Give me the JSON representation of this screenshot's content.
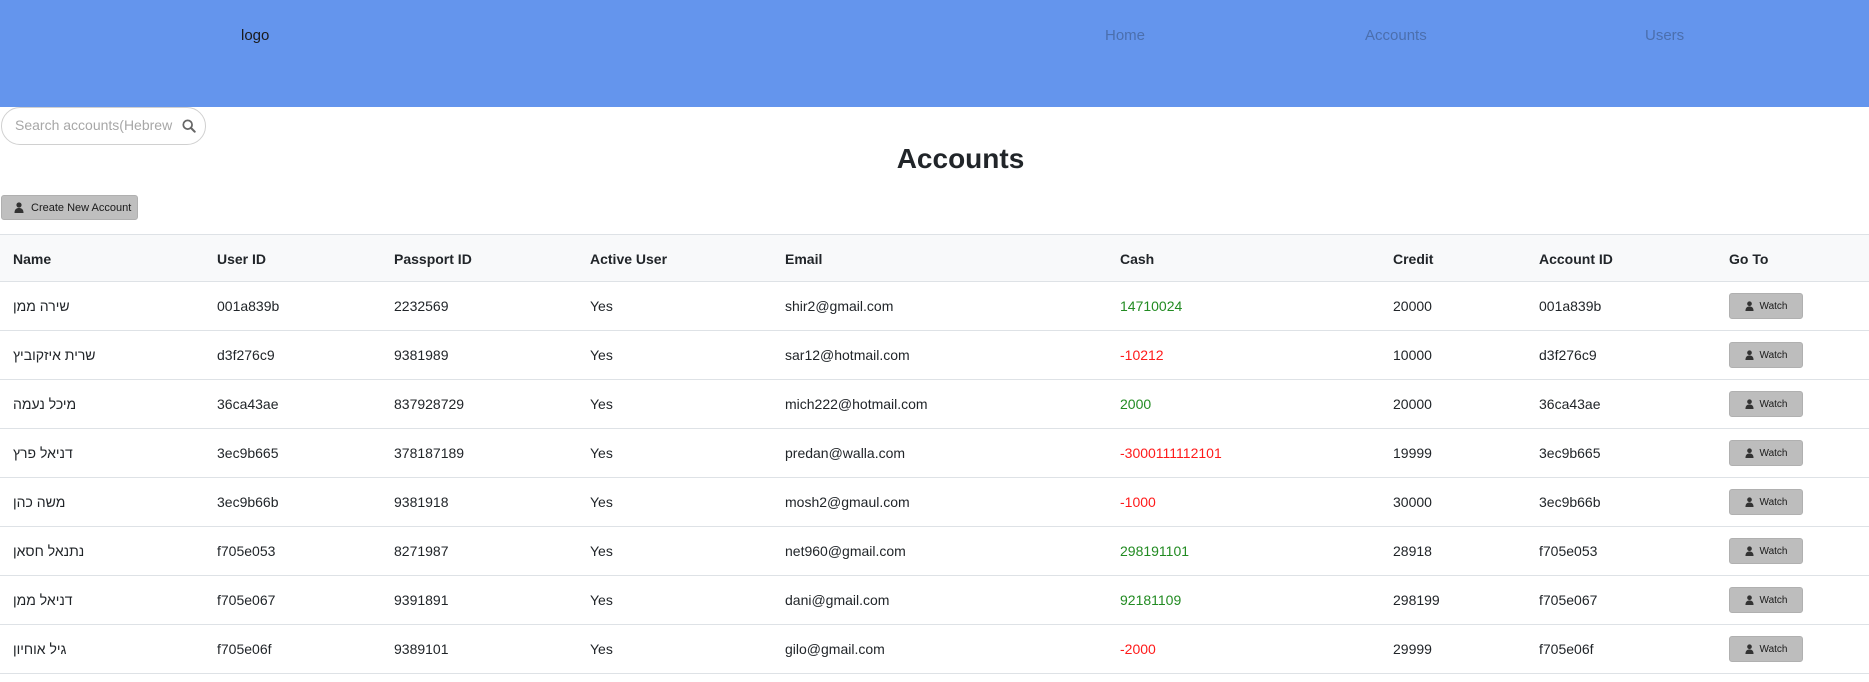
{
  "navbar": {
    "logo": "logo",
    "links": [
      "Home",
      "Accounts",
      "Users"
    ]
  },
  "search": {
    "placeholder": "Search accounts(Hebrew"
  },
  "page": {
    "title": "Accounts"
  },
  "actions": {
    "create_label": "Create New Account"
  },
  "table": {
    "headers": [
      "Name",
      "User ID",
      "Passport ID",
      "Active User",
      "Email",
      "Cash",
      "Credit",
      "Account ID",
      "Go To"
    ],
    "watch_label": "Watch",
    "rows": [
      {
        "name": "שירה ממן",
        "user_id": "001a839b",
        "passport": "2232569",
        "active": "Yes",
        "email": "shir2@gmail.com",
        "cash": "14710024",
        "cash_status": "positive",
        "credit": "20000",
        "account_id": "001a839b"
      },
      {
        "name": "שרית איזקוביץ",
        "user_id": "d3f276c9",
        "passport": "9381989",
        "active": "Yes",
        "email": "sar12@hotmail.com",
        "cash": "-10212",
        "cash_status": "negative",
        "credit": "10000",
        "account_id": "d3f276c9"
      },
      {
        "name": "מיכל נעמה",
        "user_id": "36ca43ae",
        "passport": "837928729",
        "active": "Yes",
        "email": "mich222@hotmail.com",
        "cash": "2000",
        "cash_status": "positive",
        "credit": "20000",
        "account_id": "36ca43ae"
      },
      {
        "name": "דניאל פרץ",
        "user_id": "3ec9b665",
        "passport": "378187189",
        "active": "Yes",
        "email": "predan@walla.com",
        "cash": "-3000111112101",
        "cash_status": "negative",
        "credit": "19999",
        "account_id": "3ec9b665"
      },
      {
        "name": "משה כהן",
        "user_id": "3ec9b66b",
        "passport": "9381918",
        "active": "Yes",
        "email": "mosh2@gmaul.com",
        "cash": "-1000",
        "cash_status": "negative",
        "credit": "30000",
        "account_id": "3ec9b66b"
      },
      {
        "name": "נתנאל חסאן",
        "user_id": "f705e053",
        "passport": "8271987",
        "active": "Yes",
        "email": "net960@gmail.com",
        "cash": "298191101",
        "cash_status": "positive",
        "credit": "28918",
        "account_id": "f705e053"
      },
      {
        "name": "דניאל ממן",
        "user_id": "f705e067",
        "passport": "9391891",
        "active": "Yes",
        "email": "dani@gmail.com",
        "cash": "92181109",
        "cash_status": "positive",
        "credit": "298199",
        "account_id": "f705e067"
      },
      {
        "name": "גיל אוחיון",
        "user_id": "f705e06f",
        "passport": "9389101",
        "active": "Yes",
        "email": "gilo@gmail.com",
        "cash": "-2000",
        "cash_status": "negative",
        "credit": "29999",
        "account_id": "f705e06f"
      }
    ]
  },
  "colors": {
    "navbar_bg": "#6495ed",
    "positive_cash": "#228b22",
    "negative_cash": "#ff1a1a",
    "button_bg": "#bdbdbd"
  },
  "icons": {
    "search": "search-icon",
    "user": "user-icon"
  }
}
